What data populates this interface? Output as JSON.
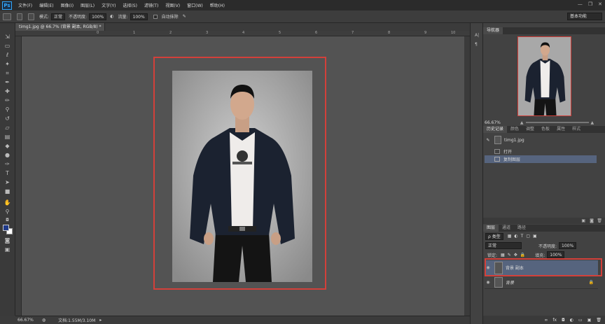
{
  "app": {
    "logo": "Ps"
  },
  "menu": [
    "文件(F)",
    "编辑(E)",
    "图像(I)",
    "图层(L)",
    "文字(Y)",
    "选择(S)",
    "滤镜(T)",
    "视图(V)",
    "窗口(W)",
    "帮助(H)"
  ],
  "window_controls": [
    "—",
    "❐",
    "✕"
  ],
  "options_bar": {
    "mode_label": "模式:",
    "mode_value": "正常",
    "opacity_label": "不透明度:",
    "opacity_value": "100%",
    "flow_label": "流量:",
    "flow_value": "100%",
    "ignore_label": "□",
    "auto_erase_label": "自动抹除",
    "workspace": "基本功能"
  },
  "document": {
    "tab_title": "timg1.jpg @ 66.7% (背景 副本, RGB/8) *",
    "zoom": "66.67%",
    "doc_info": "文档:1.55M/3.10M"
  },
  "ruler_numbers": [
    "0",
    "1",
    "2",
    "3",
    "4",
    "5",
    "6",
    "7",
    "8",
    "9",
    "10"
  ],
  "navigator": {
    "tab": "导航器",
    "zoom": "66.67%"
  },
  "history": {
    "tabs": [
      "历史记录",
      "颜色",
      "调整",
      "色板",
      "属性",
      "样式"
    ],
    "snapshot": "timg1.jpg",
    "items": [
      "打开",
      "复制图层"
    ]
  },
  "layers": {
    "tabs": [
      "图层",
      "通道",
      "路径"
    ],
    "filter_label": "ρ 类型",
    "blend_mode": "正常",
    "opacity_label": "不透明度:",
    "opacity_value": "100%",
    "lock_label": "锁定:",
    "fill_label": "填充:",
    "fill_value": "100%",
    "items": [
      {
        "name": "背景 副本",
        "selected": true
      },
      {
        "name": "背景",
        "selected": false
      }
    ]
  },
  "colors": {
    "foreground": "#1f3a8a",
    "background": "#ffffff",
    "highlight": "#d3403a"
  }
}
